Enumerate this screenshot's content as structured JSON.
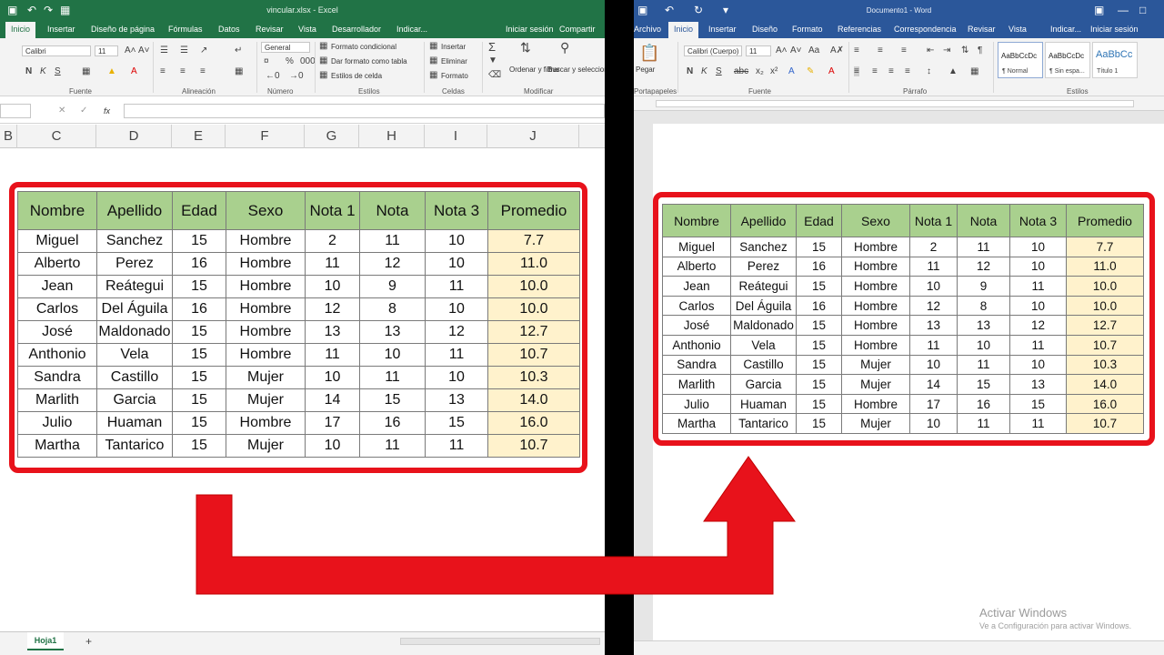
{
  "excel": {
    "title": "vincular.xlsx - Excel",
    "tabs": [
      "Inicio",
      "Insertar",
      "Diseño de página",
      "Fórmulas",
      "Datos",
      "Revisar",
      "Vista",
      "Desarrollador",
      "Indicar...",
      "Iniciar sesión",
      "Compartir"
    ],
    "font_name": "Calibri",
    "font_size": "11",
    "number_format": "General",
    "buttons": {
      "cond_format": "Formato condicional",
      "table_format": "Dar formato como tabla",
      "cell_styles": "Estilos de celda",
      "insert": "Insertar",
      "delete": "Eliminar",
      "format": "Formato",
      "sort": "Ordenar y filtrar",
      "find": "Buscar y seleccionar"
    },
    "groups": [
      "Fuente",
      "Alineación",
      "Número",
      "Estilos",
      "Celdas",
      "Modificar"
    ],
    "fx": "fx",
    "columns": [
      "B",
      "C",
      "D",
      "E",
      "F",
      "G",
      "H",
      "I",
      "J"
    ],
    "sheet_tab": "Hoja1",
    "add_sheet": "+"
  },
  "word": {
    "title": "Documento1 - Word",
    "tabs": [
      "Archivo",
      "Inicio",
      "Insertar",
      "Diseño",
      "Formato",
      "Referencias",
      "Correspondencia",
      "Revisar",
      "Vista",
      "Indicar...",
      "Iniciar sesión"
    ],
    "paste": "Pegar",
    "clipboard": "Portapapeles",
    "font_name": "Calibri (Cuerpo)",
    "font_size": "11",
    "groups": [
      "Fuente",
      "Párrafo",
      "Estilos"
    ],
    "styles": [
      {
        "sample": "AaBbCcDc",
        "name": "¶ Normal"
      },
      {
        "sample": "AaBbCcDc",
        "name": "¶ Sin espa..."
      },
      {
        "sample": "AaBbCc",
        "name": "Título 1"
      }
    ],
    "activate_title": "Activar Windows",
    "activate_sub": "Ve a Configuración para activar Windows."
  },
  "colors": {
    "excel": "#217346",
    "word": "#2b579a",
    "header": "#a9d08e",
    "average": "#fff2cc",
    "highlight": "#e8121b"
  },
  "table": {
    "headers": [
      "Nombre",
      "Apellido",
      "Edad",
      "Sexo",
      "Nota 1",
      "Nota",
      "Nota 3",
      "Promedio"
    ],
    "excel_rows": [
      [
        "Miguel",
        "Sanchez",
        "15",
        "Hombre",
        "2",
        "11",
        "10",
        "7.7"
      ],
      [
        "Alberto",
        "Perez",
        "16",
        "Hombre",
        "11",
        "12",
        "10",
        "11.0"
      ],
      [
        "Jean",
        "Reátegui",
        "15",
        "Hombre",
        "10",
        "9",
        "11",
        "10.0"
      ],
      [
        "Carlos",
        "Del Águila",
        "16",
        "Hombre",
        "12",
        "8",
        "10",
        "10.0"
      ],
      [
        "José",
        "Maldonado",
        "15",
        "Hombre",
        "13",
        "13",
        "12",
        "12.7"
      ],
      [
        "Anthonio",
        "Vela",
        "15",
        "Hombre",
        "11",
        "10",
        "11",
        "10.7"
      ],
      [
        "Sandra",
        "Castillo",
        "15",
        "Mujer",
        "10",
        "11",
        "10",
        "10.3"
      ],
      [
        "Marlith",
        "Garcia",
        "15",
        "Mujer",
        "14",
        "15",
        "13",
        "14.0"
      ],
      [
        "Julio",
        "Huaman",
        "15",
        "Hombre",
        "17",
        "16",
        "15",
        "16.0"
      ],
      [
        "Martha",
        "Tantarico",
        "15",
        "Mujer",
        "10",
        "11",
        "11",
        "10.7"
      ]
    ],
    "word_rows": [
      [
        "Miguel",
        "Sanchez",
        "15",
        "Hombre",
        "2",
        "11",
        "10",
        "7.7"
      ],
      [
        "Alberto",
        "Perez",
        "16",
        "Hombre",
        "11",
        "12",
        "10",
        "11.0"
      ],
      [
        "Jean",
        "Reátegui",
        "15",
        "Hombre",
        "10",
        "9",
        "11",
        "10.0"
      ],
      [
        "Carlos",
        "Del Águila",
        "16",
        "Hombre",
        "12",
        "8",
        "10",
        "10.0"
      ],
      [
        "José",
        "Maldonado",
        "15",
        "Hombre",
        "13",
        "13",
        "12",
        "12.7"
      ],
      [
        "Anthonio",
        "Vela",
        "15",
        "Hombre",
        "11",
        "10",
        "11",
        "10.7"
      ],
      [
        "Sandra",
        "Castillo",
        "15",
        "Mujer",
        "10",
        "11",
        "10",
        "10.3"
      ],
      [
        "Marlith",
        "Garcia",
        "15",
        "Mujer",
        "14",
        "15",
        "13",
        "14.0"
      ],
      [
        "Julio",
        "Huaman",
        "15",
        "Hombre",
        "17",
        "16",
        "15",
        "16.0"
      ],
      [
        "Martha",
        "Tantarico",
        "15",
        "Mujer",
        "10",
        "11",
        "11",
        "10.7"
      ]
    ]
  }
}
